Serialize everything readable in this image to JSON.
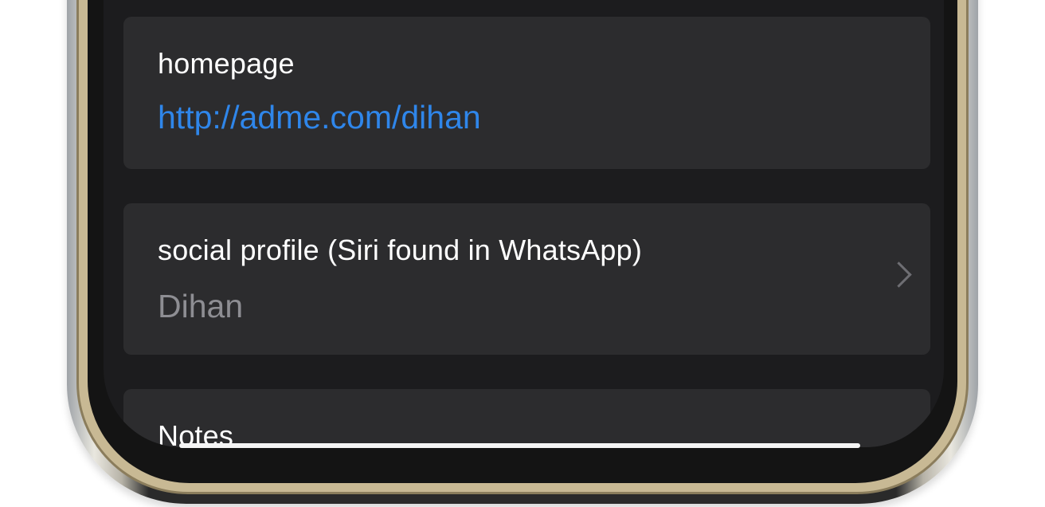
{
  "homepage": {
    "label": "homepage",
    "url": "http://adme.com/dihan"
  },
  "social_profile": {
    "label": "social profile (Siri found in WhatsApp)",
    "value": "Dihan",
    "chevron_icon": "chevron-right-icon"
  },
  "notes": {
    "label": "Notes"
  },
  "colors": {
    "background": "#1c1c1e",
    "card": "#2c2c2e",
    "link": "#2f86ea",
    "muted_text": "#8e8e93",
    "label_text": "#ffffff"
  }
}
